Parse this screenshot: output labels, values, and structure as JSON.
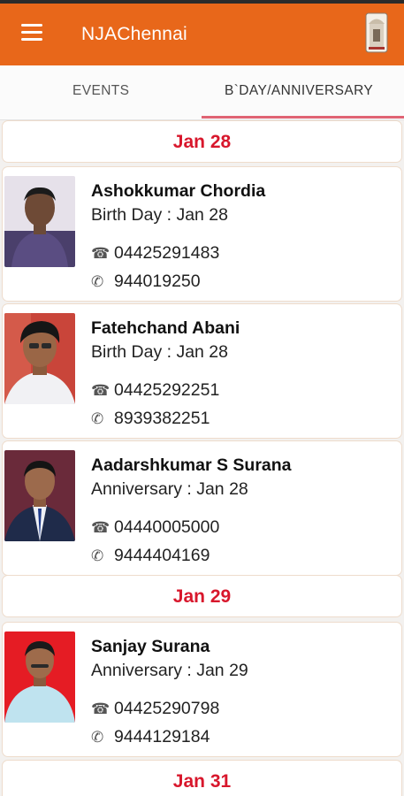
{
  "app": {
    "title": "NJAChennai"
  },
  "tabs": [
    {
      "label": "EVENTS",
      "selected": false
    },
    {
      "label": "B`DAY/ANNIVERSARY",
      "selected": true
    }
  ],
  "groups": [
    {
      "date": "Jan 28",
      "members": [
        {
          "name": "Ashokkumar Chordia",
          "occasion": "Birth Day : Jan 28",
          "landline": "04425291483",
          "mobile": "944019250"
        },
        {
          "name": "Fatehchand Abani",
          "occasion": "Birth Day : Jan 28",
          "landline": "04425292251",
          "mobile": "8939382251"
        },
        {
          "name": "Aadarshkumar S Surana",
          "occasion": "Anniversary : Jan 28",
          "landline": "04440005000",
          "mobile": "9444404169"
        }
      ]
    },
    {
      "date": "Jan 29",
      "members": [
        {
          "name": "Sanjay Surana",
          "occasion": "Anniversary : Jan 29",
          "landline": "04425290798",
          "mobile": "9444129184"
        }
      ]
    },
    {
      "date": "Jan 31",
      "members": []
    }
  ],
  "icons": {
    "menu": "hamburger-icon",
    "logo": "temple-logo-icon",
    "landline": "☎",
    "mobile": "✆"
  },
  "colors": {
    "appbar": "#e8671a",
    "date_header_text": "#d8172c",
    "tab_indicator": "#e06474"
  }
}
